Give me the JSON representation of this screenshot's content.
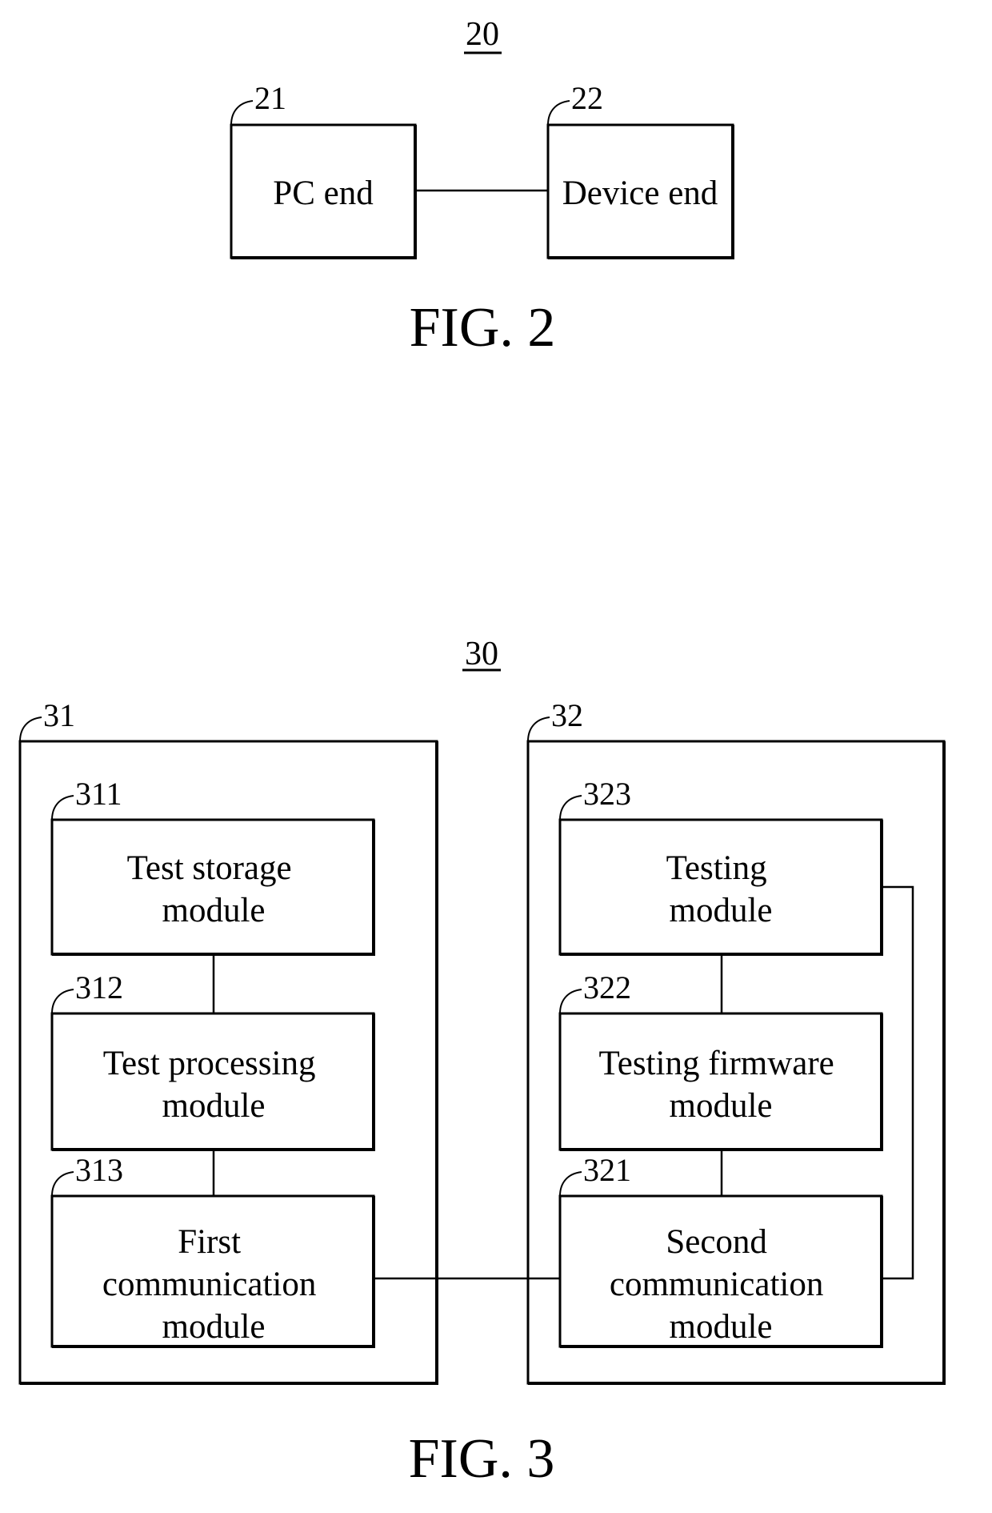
{
  "figures": [
    {
      "caption": "FIG. 2",
      "system_number": "20",
      "blocks": [
        {
          "ref": "21",
          "lines": [
            "PC end"
          ]
        },
        {
          "ref": "22",
          "lines": [
            "Device end"
          ]
        }
      ],
      "connections": [
        [
          "21",
          "22"
        ]
      ]
    },
    {
      "caption": "FIG. 3",
      "system_number": "30",
      "groups": [
        {
          "ref": "31",
          "blocks": [
            {
              "ref": "311",
              "lines": [
                "Test storage",
                "module"
              ]
            },
            {
              "ref": "312",
              "lines": [
                "Test processing",
                "module"
              ]
            },
            {
              "ref": "313",
              "lines": [
                "First",
                "communication",
                "module"
              ]
            }
          ]
        },
        {
          "ref": "32",
          "blocks": [
            {
              "ref": "323",
              "lines": [
                "Testing",
                "module"
              ]
            },
            {
              "ref": "322",
              "lines": [
                "Testing firmware",
                "module"
              ]
            },
            {
              "ref": "321",
              "lines": [
                "Second",
                "communication",
                "module"
              ]
            }
          ]
        }
      ],
      "connections": [
        [
          "311",
          "312"
        ],
        [
          "312",
          "313"
        ],
        [
          "313",
          "321"
        ],
        [
          "323",
          "322"
        ],
        [
          "322",
          "321"
        ],
        [
          "323",
          "321"
        ]
      ]
    }
  ]
}
